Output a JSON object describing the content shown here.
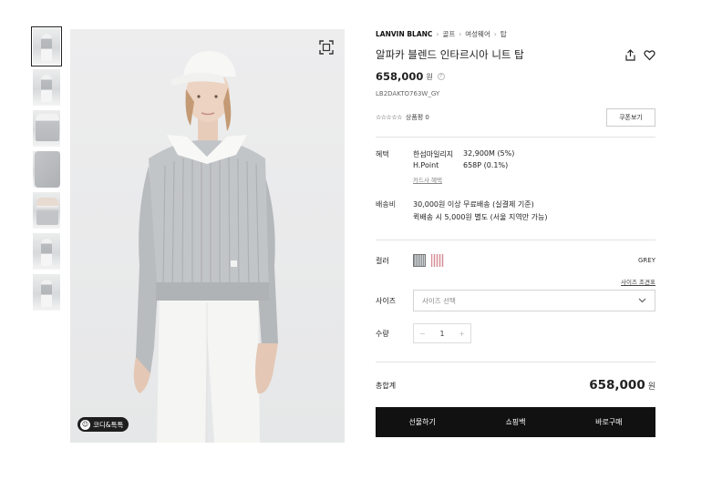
{
  "breadcrumb": {
    "brand": "LANVIN BLANC",
    "cat1": "골프",
    "cat2": "여성웨어",
    "cat3": "탑"
  },
  "product": {
    "title": "알파카 블렌드 인타르시아 니트 탑",
    "price": "658,000",
    "currency": "원",
    "code": "LB2DAKTO763W_GY",
    "stars": "☆☆☆☆☆",
    "review_label": "상품평 0",
    "coupon_label": "쿠폰보기"
  },
  "benefit": {
    "label": "혜택",
    "items": [
      {
        "name": "한섬마일리지",
        "value": "32,900M (5%)"
      },
      {
        "name": "H.Point",
        "value": "658P (0.1%)"
      }
    ],
    "card_link": "카드사 혜택"
  },
  "shipping": {
    "label": "배송비",
    "line1": "30,000원 이상 무료배송 (실결제 기준)",
    "line2": "퀵배송 시 5,000원 별도 (서울 지역만 가능)"
  },
  "options": {
    "color_label": "컬러",
    "color_name": "GREY",
    "size_guide": "사이즈 조견표",
    "size_label": "사이즈",
    "size_placeholder": "사이즈 선택",
    "qty_label": "수량",
    "qty_value": "1"
  },
  "total": {
    "label": "총합계",
    "amount": "658,000",
    "currency": "원"
  },
  "actions": {
    "gift": "선물하기",
    "bag": "쇼핑백",
    "buy": "바로구매"
  },
  "image": {
    "badge_label": "코디&톡톡"
  },
  "colors": {
    "buy_bar": "#111111",
    "swatch_grey": "#8f9396",
    "swatch_pink": "#d98b96"
  }
}
